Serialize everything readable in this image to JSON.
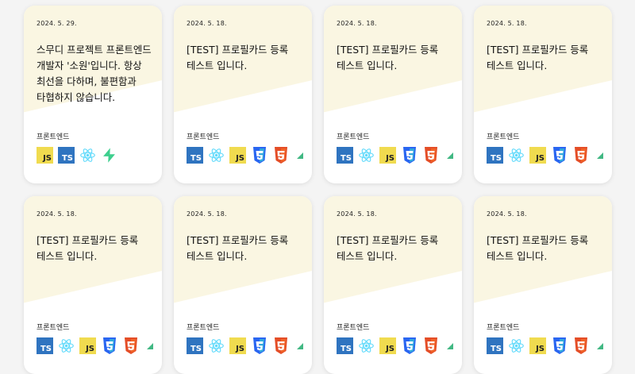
{
  "cards": [
    {
      "date": "2024. 5. 29.",
      "title": "스무디 프로젝트 프론트엔드 개발자 '소원'입니다. 항상 최선을 다하며, 불편함과 타협하지 않습니다.",
      "category": "프론트엔드",
      "stack": [
        {
          "type": "js",
          "label": "JS"
        },
        {
          "type": "ts",
          "label": "TS"
        },
        {
          "type": "react"
        },
        {
          "type": "supabase"
        }
      ]
    },
    {
      "date": "2024. 5. 18.",
      "title": "[TEST] 프로필카드 등록 테스트 입니다.",
      "category": "프론트엔드",
      "stack": [
        {
          "type": "ts",
          "label": "TS"
        },
        {
          "type": "react"
        },
        {
          "type": "js",
          "label": "JS"
        },
        {
          "type": "css3"
        },
        {
          "type": "html5"
        },
        {
          "type": "vue"
        }
      ]
    },
    {
      "date": "2024. 5. 18.",
      "title": "[TEST] 프로필카드 등록 테스트 입니다.",
      "category": "프론트엔드",
      "stack": [
        {
          "type": "ts",
          "label": "TS"
        },
        {
          "type": "react"
        },
        {
          "type": "js",
          "label": "JS"
        },
        {
          "type": "css3"
        },
        {
          "type": "html5"
        },
        {
          "type": "vue"
        }
      ]
    },
    {
      "date": "2024. 5. 18.",
      "title": "[TEST] 프로필카드 등록 테스트 입니다.",
      "category": "프론트엔드",
      "stack": [
        {
          "type": "ts",
          "label": "TS"
        },
        {
          "type": "react"
        },
        {
          "type": "js",
          "label": "JS"
        },
        {
          "type": "css3"
        },
        {
          "type": "html5"
        },
        {
          "type": "vue"
        }
      ]
    },
    {
      "date": "2024. 5. 18.",
      "title": "[TEST] 프로필카드 등록 테스트 입니다.",
      "category": "프론트엔드",
      "stack": [
        {
          "type": "ts",
          "label": "TS"
        },
        {
          "type": "react"
        },
        {
          "type": "js",
          "label": "JS"
        },
        {
          "type": "css3"
        },
        {
          "type": "html5"
        },
        {
          "type": "vue"
        }
      ]
    },
    {
      "date": "2024. 5. 18.",
      "title": "[TEST] 프로필카드 등록 테스트 입니다.",
      "category": "프론트엔드",
      "stack": [
        {
          "type": "ts",
          "label": "TS"
        },
        {
          "type": "react"
        },
        {
          "type": "js",
          "label": "JS"
        },
        {
          "type": "css3"
        },
        {
          "type": "html5"
        },
        {
          "type": "vue"
        }
      ]
    },
    {
      "date": "2024. 5. 18.",
      "title": "[TEST] 프로필카드 등록 테스트 입니다.",
      "category": "프론트엔드",
      "stack": [
        {
          "type": "ts",
          "label": "TS"
        },
        {
          "type": "react"
        },
        {
          "type": "js",
          "label": "JS"
        },
        {
          "type": "css3"
        },
        {
          "type": "html5"
        },
        {
          "type": "vue"
        }
      ]
    },
    {
      "date": "2024. 5. 18.",
      "title": "[TEST] 프로필카드 등록 테스트 입니다.",
      "category": "프론트엔드",
      "stack": [
        {
          "type": "ts",
          "label": "TS"
        },
        {
          "type": "react"
        },
        {
          "type": "js",
          "label": "JS"
        },
        {
          "type": "css3"
        },
        {
          "type": "html5"
        },
        {
          "type": "vue"
        }
      ]
    }
  ],
  "colors": {
    "card_accent": "#faf6e2",
    "js": "#f0db4f",
    "ts": "#2f74c0",
    "react": "#61dafb",
    "css3": "#2965f1",
    "html5": "#e44d26",
    "vue": "#41b883",
    "supabase": "#3ecf8e"
  }
}
